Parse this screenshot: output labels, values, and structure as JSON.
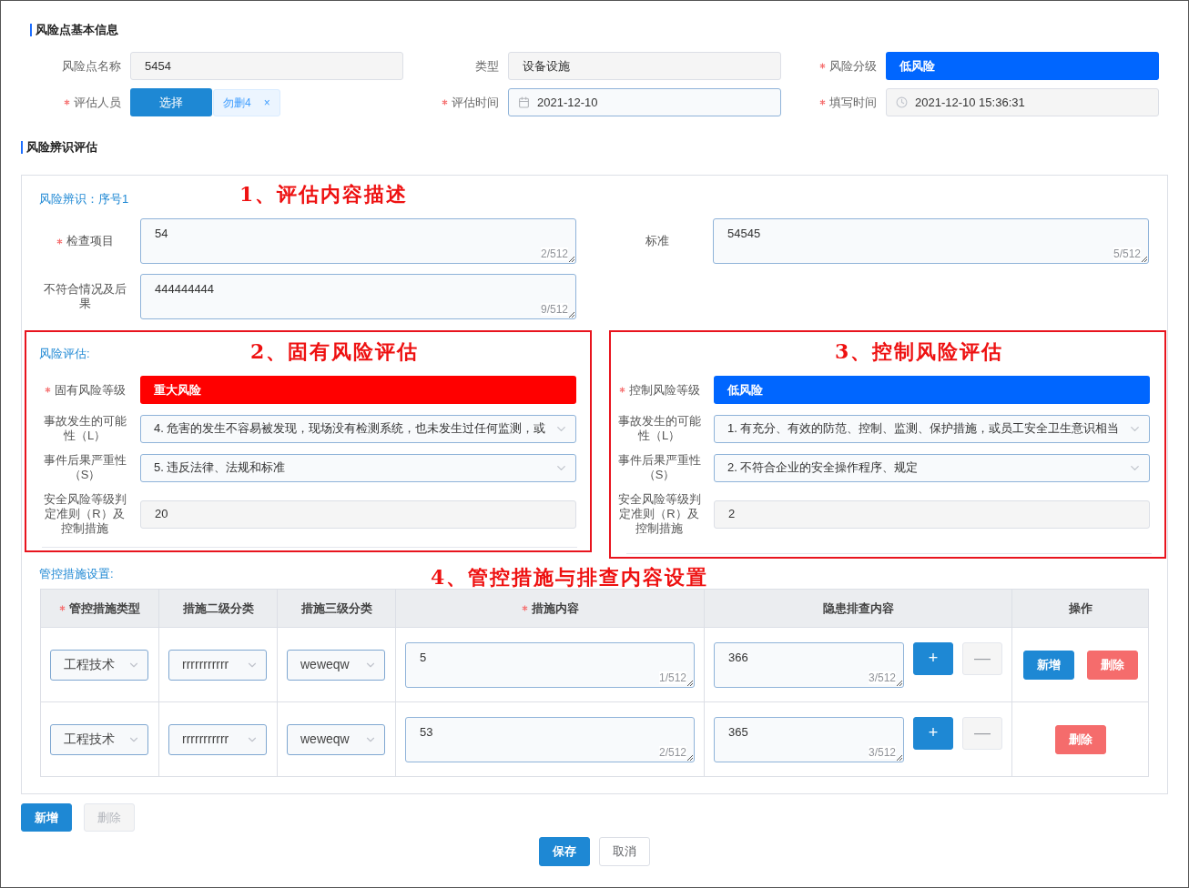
{
  "basic_info": {
    "title": "风险点基本信息",
    "fields": [
      {
        "kind": "readonly",
        "label": "风险点名称",
        "required": false,
        "value": "5454"
      },
      {
        "kind": "readonly",
        "label": "类型",
        "required": false,
        "value": "设备设施"
      },
      {
        "kind": "level",
        "label": "风险分级",
        "required": true,
        "value": "低风险",
        "color": "#0066ff"
      },
      {
        "kind": "person",
        "label": "评估人员",
        "required": true,
        "button": "选择",
        "tag": "勿删4",
        "tag_close": "×"
      },
      {
        "kind": "date",
        "label": "评估时间",
        "required": true,
        "value": "2021-12-10"
      },
      {
        "kind": "datetime",
        "label": "填写时间",
        "required": true,
        "value": "2021-12-10 15:36:31"
      }
    ]
  },
  "identification": {
    "title": "风险辨识评估",
    "subtitle": "风险辨识：序号1",
    "annotation": "1、评估内容描述",
    "fields": [
      {
        "label": "检查项目",
        "required": true,
        "value": "54",
        "counter": "2/512"
      },
      {
        "label": "标准",
        "required": false,
        "value": "54545",
        "counter": "5/512"
      },
      {
        "label": "不符合情况及后果",
        "required": false,
        "value": "444444444",
        "counter": "9/512"
      }
    ]
  },
  "assessments": [
    {
      "subtitle": "风险评估:",
      "annotation": "2、固有风险评估",
      "fields": [
        {
          "kind": "level",
          "label": "固有风险等级",
          "required": true,
          "value": "重大风险",
          "color": "#ff0000"
        },
        {
          "kind": "select",
          "label": "事故发生的可能性（L）",
          "required": false,
          "value": "4. 危害的发生不容易被发现，现场没有检测系统，也未发生过任何监测，或"
        },
        {
          "kind": "select",
          "label": "事件后果严重性（S）",
          "required": false,
          "value": "5. 违反法律、法规和标准"
        },
        {
          "kind": "readonly",
          "label": "安全风险等级判定准则（R）及控制措施",
          "required": false,
          "value": "20"
        }
      ]
    },
    {
      "annotation": "3、控制风险评估",
      "fields": [
        {
          "kind": "level",
          "label": "控制风险等级",
          "required": true,
          "value": "低风险",
          "color": "#0066ff"
        },
        {
          "kind": "select",
          "label": "事故发生的可能性（L）",
          "required": false,
          "value": "1. 有充分、有效的防范、控制、监测、保护措施，或员工安全卫生意识相当"
        },
        {
          "kind": "select",
          "label": "事件后果严重性（S）",
          "required": false,
          "value": "2. 不符合企业的安全操作程序、规定"
        },
        {
          "kind": "readonly",
          "label": "安全风险等级判定准则（R）及控制措施",
          "required": false,
          "value": "2"
        }
      ]
    }
  ],
  "measures": {
    "subtitle": "管控措施设置:",
    "annotation": "4、管控措施与排查内容设置",
    "columns": [
      {
        "label": "管控措施类型",
        "required": true
      },
      {
        "label": "措施二级分类",
        "required": false
      },
      {
        "label": "措施三级分类",
        "required": false
      },
      {
        "label": "措施内容",
        "required": true
      },
      {
        "label": "隐患排查内容",
        "required": false
      },
      {
        "label": "操作",
        "required": false
      }
    ],
    "rows": [
      {
        "type": "工程技术",
        "level2": "rrrrrrrrrrr",
        "level3": "weweqw",
        "content": "5",
        "content_counter": "1/512",
        "check": "366",
        "check_counter": "3/512",
        "check_buttons": [
          {
            "label": "+",
            "disabled": false
          },
          {
            "label": "—",
            "disabled": true
          }
        ],
        "actions": [
          {
            "label": "新增",
            "kind": "primary"
          },
          {
            "label": "删除",
            "kind": "danger"
          }
        ]
      },
      {
        "type": "工程技术",
        "level2": "rrrrrrrrrrr",
        "level3": "weweqw",
        "content": "53",
        "content_counter": "2/512",
        "check": "365",
        "check_counter": "3/512",
        "check_buttons": [
          {
            "label": "+",
            "disabled": false
          },
          {
            "label": "—",
            "disabled": true
          }
        ],
        "actions": [
          {
            "label": "删除",
            "kind": "danger"
          }
        ]
      }
    ]
  },
  "form_buttons": [
    {
      "label": "新增",
      "kind": "primary",
      "disabled": false
    },
    {
      "label": "删除",
      "kind": "default",
      "disabled": true
    }
  ],
  "dialog_buttons": [
    {
      "label": "保存",
      "kind": "primary",
      "disabled": false
    },
    {
      "label": "取消",
      "kind": "default",
      "disabled": false
    }
  ]
}
